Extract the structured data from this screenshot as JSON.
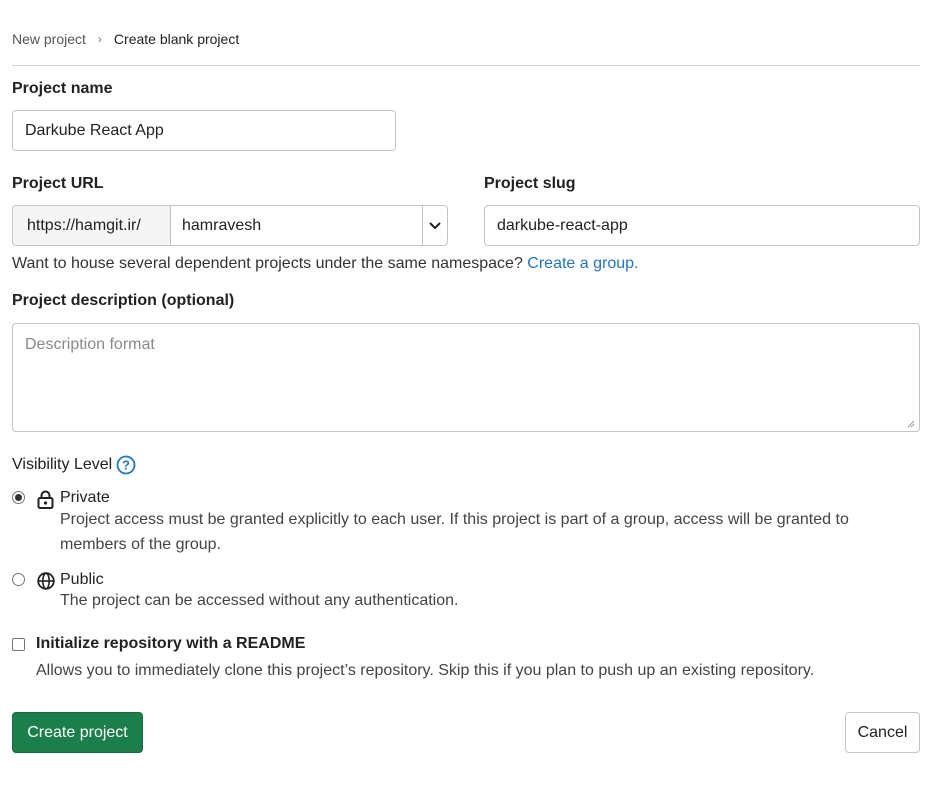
{
  "breadcrumb": {
    "items": [
      "New project",
      "Create blank project"
    ]
  },
  "form": {
    "project_name": {
      "label": "Project name",
      "value": "Darkube React App"
    },
    "project_url": {
      "label": "Project URL",
      "prefix": "https://hamgit.ir/",
      "namespace": "hamravesh"
    },
    "project_slug": {
      "label": "Project slug",
      "value": "darkube-react-app"
    },
    "namespace_help": {
      "text": "Want to house several dependent projects under the same namespace?",
      "link": "Create a group."
    },
    "description": {
      "label": "Project description (optional)",
      "placeholder": "Description format"
    },
    "visibility": {
      "label": "Visibility Level",
      "options": [
        {
          "title": "Private",
          "description": "Project access must be granted explicitly to each user. If this project is part of a group, access will be granted to members of the group.",
          "icon": "lock-icon",
          "selected": true
        },
        {
          "title": "Public",
          "description": "The project can be accessed without any authentication.",
          "icon": "globe-icon",
          "selected": false
        }
      ]
    },
    "readme": {
      "label": "Initialize repository with a README",
      "description": "Allows you to immediately clone this project’s repository. Skip this if you plan to push up an existing repository.",
      "checked": false
    }
  },
  "actions": {
    "create_label": "Create project",
    "cancel_label": "Cancel"
  },
  "colors": {
    "primary": "#1a7f4b",
    "link": "#1f75cb"
  }
}
